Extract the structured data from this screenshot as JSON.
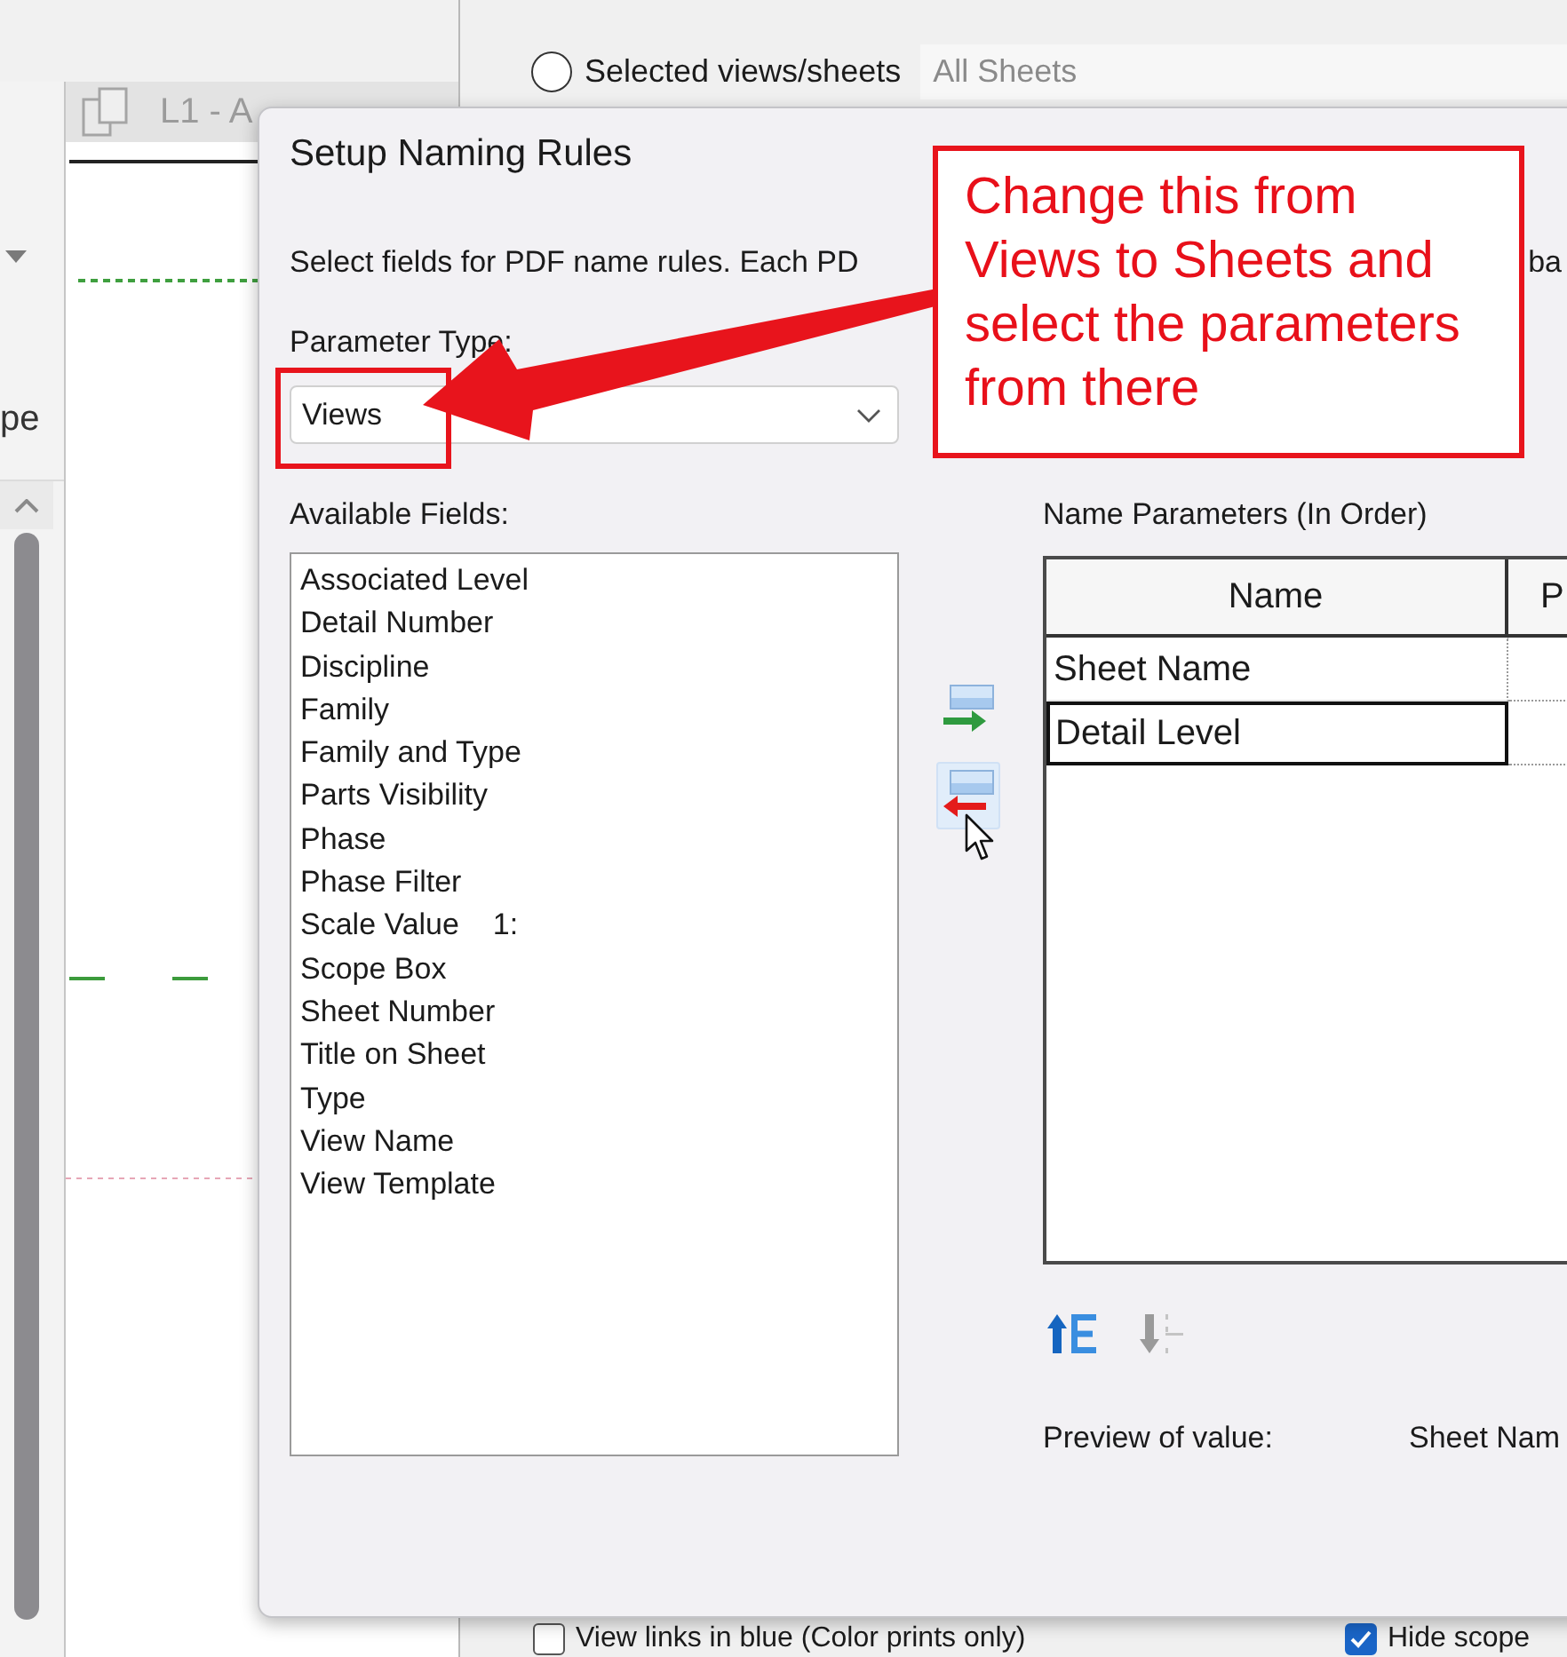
{
  "background": {
    "side_label": "pe",
    "tab": {
      "label": "L1 - A"
    },
    "print_range": {
      "radio": {
        "label": "Selected views/sheets",
        "selected": false
      },
      "field": {
        "value": "All Sheets",
        "disabled": true
      }
    },
    "options": [
      {
        "label": "View links in blue (Color prints only)",
        "checked": false
      },
      {
        "label": "Hide scope",
        "checked": true
      }
    ]
  },
  "dialog": {
    "title": "Setup Naming Rules",
    "instruction": "Select fields for PDF name rules. Each PD",
    "instruction_tail": "ba",
    "parameter_type": {
      "label": "Parameter Type:",
      "value": "Views"
    },
    "available_fields": {
      "label": "Available Fields:",
      "items": [
        {
          "name": "Associated Level",
          "selected": false
        },
        {
          "name": "Detail Number",
          "selected": false
        },
        {
          "name": "Discipline",
          "selected": false
        },
        {
          "name": "Family",
          "selected": false
        },
        {
          "name": "Family and Type",
          "selected": false
        },
        {
          "name": "Parts Visibility",
          "selected": false
        },
        {
          "name": "Phase",
          "selected": false
        },
        {
          "name": "Phase Filter",
          "selected": false
        },
        {
          "name": "Scale Value    1:",
          "selected": false
        },
        {
          "name": "Scope Box",
          "selected": false
        },
        {
          "name": "Sheet Number",
          "selected": false
        },
        {
          "name": "Title on Sheet",
          "selected": false
        },
        {
          "name": "Type",
          "selected": false
        },
        {
          "name": "View Name",
          "selected": false
        },
        {
          "name": "View Template",
          "selected": false
        }
      ]
    },
    "transfer_buttons": [
      {
        "kind": "add",
        "hovered": false
      },
      {
        "kind": "remove",
        "hovered": true
      }
    ],
    "name_parameters": {
      "label": "Name Parameters (In Order)",
      "columns": [
        "Name",
        "P"
      ],
      "rows": [
        {
          "name": "Sheet Name",
          "selected": false
        },
        {
          "name": "Detail Level",
          "selected": true
        }
      ]
    },
    "order_buttons": [
      {
        "kind": "up",
        "disabled": false
      },
      {
        "kind": "down",
        "disabled": true
      }
    ],
    "preview": {
      "label": "Preview of value:",
      "value": "Sheet Nam"
    }
  },
  "annotation": {
    "text": "Change this from Views to Sheets and select the parameters from there"
  }
}
